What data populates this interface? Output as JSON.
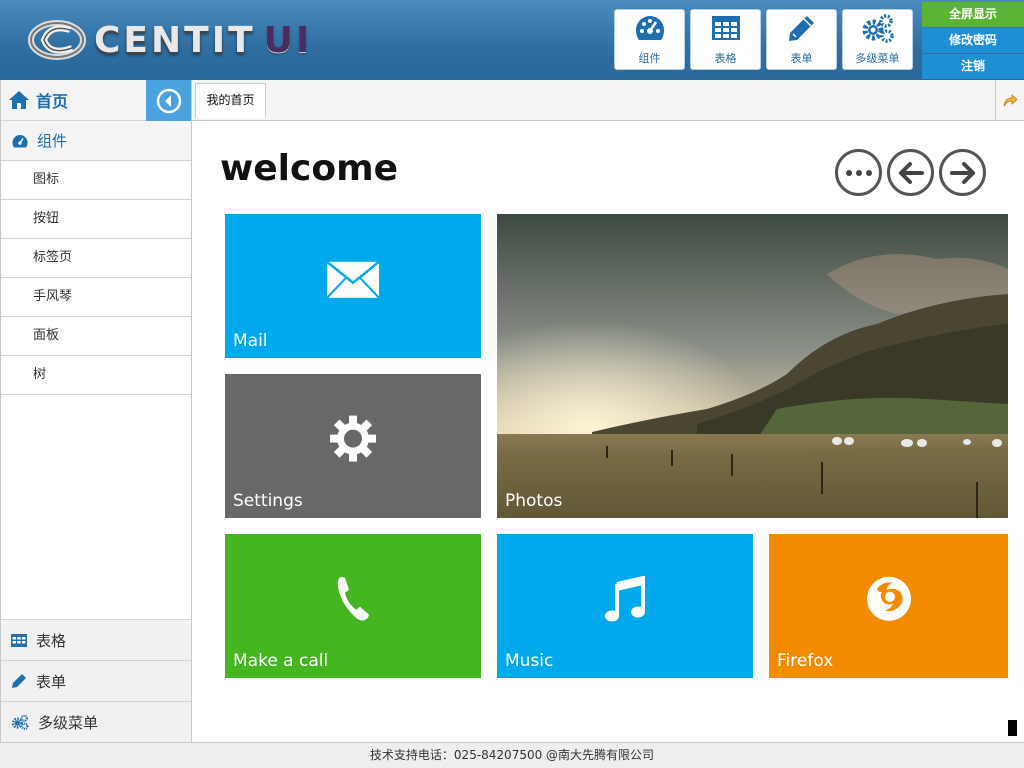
{
  "header": {
    "logo_text": "CENTIT",
    "logo_suffix": "UI",
    "nav": [
      {
        "label": "组件",
        "icon": "dashboard-icon"
      },
      {
        "label": "表格",
        "icon": "table-icon"
      },
      {
        "label": "表单",
        "icon": "pencil-icon"
      },
      {
        "label": "多级菜单",
        "icon": "gears-icon"
      }
    ],
    "links": {
      "fullscreen": "全屏显示",
      "change_password": "修改密码",
      "logout": "注销"
    }
  },
  "sidebar": {
    "home": "首页",
    "section": "组件",
    "items": [
      "图标",
      "按钮",
      "标签页",
      "手风琴",
      "面板",
      "树"
    ],
    "bottom": [
      {
        "label": "表格",
        "icon": "table-icon"
      },
      {
        "label": "表单",
        "icon": "pencil-icon"
      },
      {
        "label": "多级菜单",
        "icon": "gears-icon"
      }
    ]
  },
  "tabs": [
    {
      "label": "我的首页"
    }
  ],
  "main": {
    "title": "welcome",
    "tiles": {
      "mail": {
        "label": "Mail",
        "color": "#00a8ec"
      },
      "settings": {
        "label": "Settings",
        "color": "#686868"
      },
      "photos": {
        "label": "Photos"
      },
      "call": {
        "label": "Make a call",
        "color": "#45b520"
      },
      "music": {
        "label": "Music",
        "color": "#00a8ec"
      },
      "firefox": {
        "label": "Firefox",
        "color": "#f28b00"
      }
    }
  },
  "footer": {
    "text": "技术支持电话：025-84207500 @南大先腾有限公司"
  },
  "colors": {
    "header": "#3a7bb0",
    "accent": "#1e6eb0",
    "green": "#5bb332",
    "blue": "#1e8fd5"
  }
}
